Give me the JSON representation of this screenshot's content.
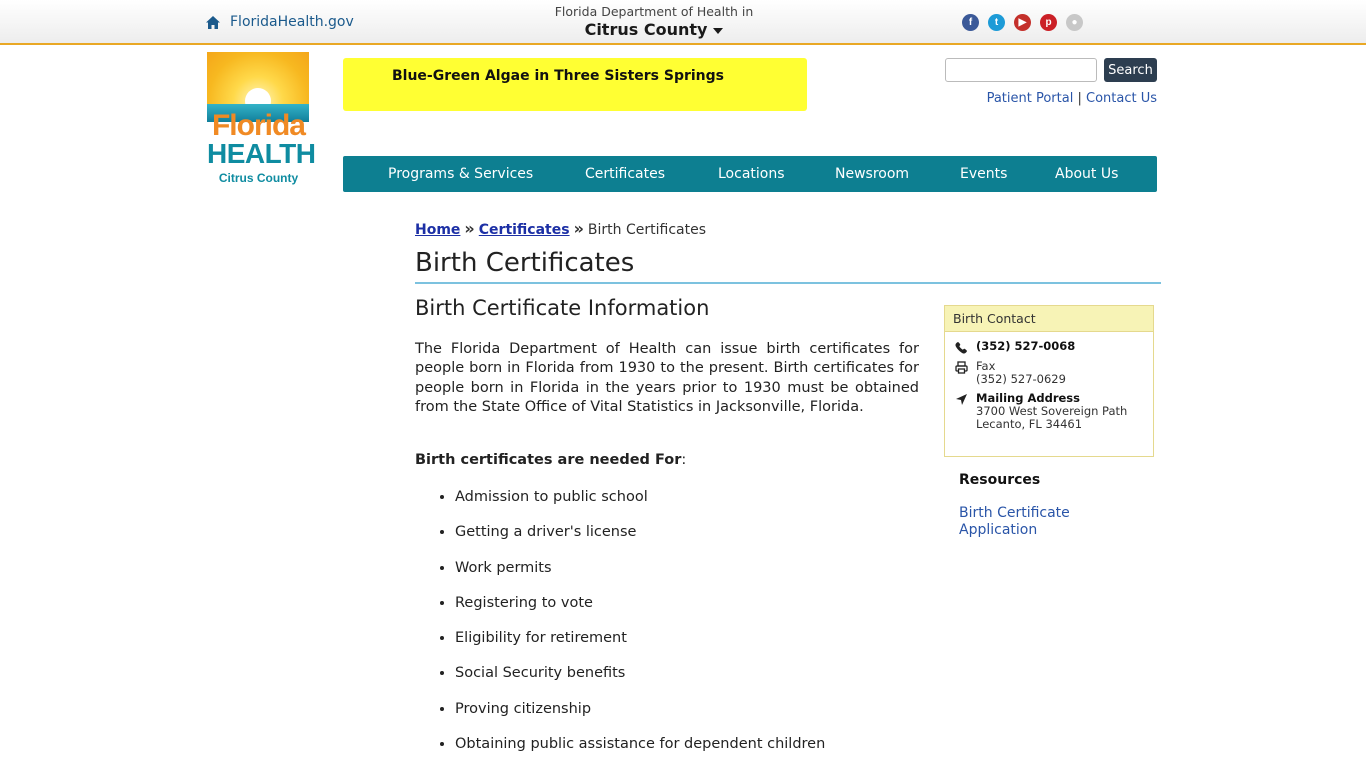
{
  "topbar": {
    "home_link": "FloridaHealth.gov",
    "dept_line1": "Florida Department of Health in",
    "dept_line2": "Citrus County",
    "social": [
      {
        "icon": "facebook-icon",
        "glyph": "f",
        "color": "#3b5998"
      },
      {
        "icon": "twitter-icon",
        "glyph": "t",
        "color": "#1d9bd7"
      },
      {
        "icon": "youtube-icon",
        "glyph": "▶",
        "color": "#c4302b"
      },
      {
        "icon": "pinterest-icon",
        "glyph": "p",
        "color": "#cb2027"
      },
      {
        "icon": "flickr-icon",
        "glyph": "●",
        "color": "#c8c8c8"
      }
    ]
  },
  "logo": {
    "line1": "Florida",
    "line2": "HEALTH",
    "line3": "Citrus County"
  },
  "alert": {
    "text": "Blue-Green Algae in Three Sisters Springs",
    "color": "#ffff33"
  },
  "search": {
    "value": "",
    "button": "Search"
  },
  "utility_links": {
    "patient_portal": "Patient Portal",
    "separator": "|",
    "contact_us": "Contact Us"
  },
  "nav": {
    "color": "#0d7f91",
    "items": [
      "Programs & Services",
      "Certificates",
      "Locations",
      "Newsroom",
      "Events",
      "About Us"
    ]
  },
  "breadcrumb": {
    "home": "Home",
    "sep": "»",
    "certificates": "Certificates",
    "current": "Birth Certificates"
  },
  "page": {
    "title": "Birth Certificates",
    "section_heading": "Birth Certificate Information",
    "intro": "The Florida Department of Health can issue birth certificates for people born in Florida from 1930 to the present. Birth certificates for people born in Florida in the years prior to 1930 must be obtained from the State Office of Vital Statistics in Jacksonville, Florida.",
    "needed_bold": "Birth certificates are needed For",
    "needed_colon": ":",
    "uses": [
      "Admission to public school",
      "Getting a driver's license",
      "Work permits",
      "Registering to vote",
      "Eligibility for retirement",
      "Social Security benefits",
      "Proving citizenship",
      "Obtaining public assistance for dependent children"
    ]
  },
  "contact": {
    "heading": "Birth Contact",
    "phone": "(352) 527-0068",
    "fax_label": "Fax",
    "fax": "(352) 527-0629",
    "mail_label": "Mailing Address",
    "address_line1": "3700 West Sovereign Path",
    "address_line2": "Lecanto, FL 34461"
  },
  "resources": {
    "title": "Resources",
    "link": "Birth Certificate Application"
  }
}
